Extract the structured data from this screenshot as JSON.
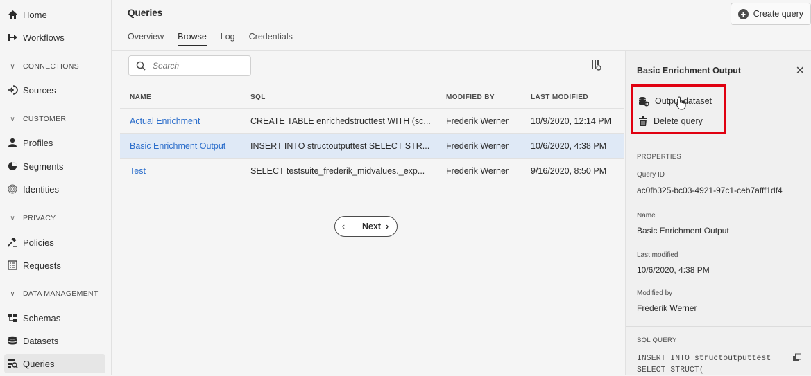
{
  "sidebar": {
    "items": [
      {
        "label": "Home"
      },
      {
        "label": "Workflows"
      },
      {
        "label": "Sources"
      },
      {
        "label": "Profiles"
      },
      {
        "label": "Segments"
      },
      {
        "label": "Identities"
      },
      {
        "label": "Policies"
      },
      {
        "label": "Requests"
      },
      {
        "label": "Schemas"
      },
      {
        "label": "Datasets"
      },
      {
        "label": "Queries"
      }
    ],
    "sections": [
      {
        "label": "CONNECTIONS"
      },
      {
        "label": "CUSTOMER"
      },
      {
        "label": "PRIVACY"
      },
      {
        "label": "DATA MANAGEMENT"
      }
    ]
  },
  "header": {
    "title": "Queries",
    "create_label": "Create query",
    "tabs": [
      {
        "label": "Overview"
      },
      {
        "label": "Browse"
      },
      {
        "label": "Log"
      },
      {
        "label": "Credentials"
      }
    ]
  },
  "search": {
    "placeholder": "Search"
  },
  "table": {
    "headers": [
      "NAME",
      "SQL",
      "MODIFIED BY",
      "LAST MODIFIED"
    ],
    "rows": [
      {
        "name": "Actual Enrichment",
        "sql": "CREATE TABLE enrichedstructtest WITH (sc...",
        "modified_by": "Frederik Werner",
        "last_modified": "10/9/2020, 12:14 PM"
      },
      {
        "name": "Basic Enrichment Output",
        "sql": "INSERT INTO structoutputtest SELECT STR...",
        "modified_by": "Frederik Werner",
        "last_modified": "10/6/2020, 4:38 PM"
      },
      {
        "name": "Test",
        "sql": "SELECT testsuite_frederik_midvalues._exp...",
        "modified_by": "Frederik Werner",
        "last_modified": "9/16/2020, 8:50 PM"
      }
    ],
    "selected_index": 1
  },
  "pager": {
    "prev": "‹",
    "next_label": "Next",
    "next_arrow": "›"
  },
  "panel": {
    "title": "Basic Enrichment Output",
    "actions": [
      {
        "label": "Output dataset"
      },
      {
        "label": "Delete query"
      }
    ],
    "properties_heading": "PROPERTIES",
    "query_id_label": "Query ID",
    "query_id": "ac0fb325-bc03-4921-97c1-ceb7afff1df4",
    "name_label": "Name",
    "name": "Basic Enrichment Output",
    "last_modified_label": "Last modified",
    "last_modified": "10/6/2020, 4:38 PM",
    "modified_by_label": "Modified by",
    "modified_by": "Frederik Werner",
    "sql_heading": "SQL QUERY",
    "sql_line1": "INSERT INTO structoutputtest",
    "sql_line2": "SELECT STRUCT("
  },
  "colors": {
    "link": "#2c6ecb",
    "selected_row": "#dfe9f6",
    "highlight": "#e00010"
  }
}
